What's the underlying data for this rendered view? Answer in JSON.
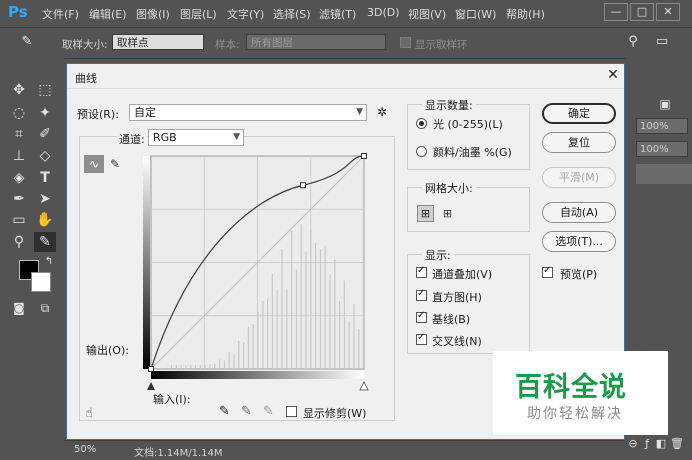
{
  "app": {
    "logo": "Ps"
  },
  "menu": [
    "文件(F)",
    "编辑(E)",
    "图像(I)",
    "图层(L)",
    "文字(Y)",
    "选择(S)",
    "滤镜(T)",
    "3D(D)",
    "视图(V)",
    "窗口(W)",
    "帮助(H)"
  ],
  "window_controls": [
    "—",
    "□",
    "✕"
  ],
  "options_bar": {
    "sample_size_label": "取样大小:",
    "sample_size_value": "取样点",
    "sample_label": "样本:",
    "sample_value": "所有图层",
    "show_ring_label": "显示取样环"
  },
  "right_panel": {
    "opacity_1": "100%",
    "opacity_2": "100%"
  },
  "status": {
    "zoom": "50%",
    "doc": "文档:1.14M/1.14M"
  },
  "dialog": {
    "title": "曲线",
    "preset_label": "预设(R):",
    "preset_value": "自定",
    "channel_label": "通道:",
    "channel_value": "RGB",
    "output_label": "输出(O):",
    "input_label": "输入(I):",
    "show_clipping_label": "显示修剪(W)",
    "show_amount": {
      "title": "显示数量:",
      "light_label": "光 (0-255)(L)",
      "pigment_label": "颜料/油墨 %(G)"
    },
    "grid_size": {
      "title": "网格大小:"
    },
    "show": {
      "title": "显示:",
      "channel_overlay": "通道叠加(V)",
      "histogram": "直方图(H)",
      "baseline": "基线(B)",
      "intersection": "交叉线(N)"
    },
    "buttons": {
      "ok": "确定",
      "reset": "复位",
      "smooth": "平滑(M)",
      "auto": "自动(A)",
      "options": "选项(T)...",
      "preview": "预览(P)"
    }
  },
  "curve": {
    "points": [
      [
        0,
        0
      ],
      [
        182,
        220
      ],
      [
        255,
        255
      ]
    ],
    "histogram_colors": {
      "bar": "#c8c8c8",
      "curve": "#3a3a3a"
    }
  },
  "watermark": {
    "big": "百科全说",
    "small": "助你轻松解决"
  }
}
